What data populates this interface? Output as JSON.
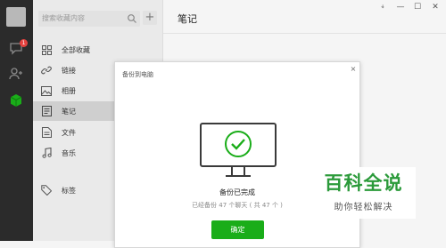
{
  "search": {
    "placeholder": "搜索收藏内容"
  },
  "side": {
    "badge": "1"
  },
  "menu": [
    {
      "label": "全部收藏",
      "icon": "grid-icon"
    },
    {
      "label": "链接",
      "icon": "link-icon"
    },
    {
      "label": "相册",
      "icon": "image-icon"
    },
    {
      "label": "笔记",
      "icon": "note-icon",
      "active": true
    },
    {
      "label": "文件",
      "icon": "file-icon"
    },
    {
      "label": "音乐",
      "icon": "music-icon"
    },
    {
      "label": "标签",
      "icon": "tag-icon"
    }
  ],
  "page": {
    "title": "笔记"
  },
  "window": {
    "pin": "⍖",
    "minimize": "—",
    "maximize": "☐",
    "close": "✕"
  },
  "dialog": {
    "title": "备份到电脑",
    "close": "×",
    "status": "备份已完成",
    "detail": "已经备份 47 个聊天 ( 共 47 个 )",
    "confirm": "确定"
  },
  "watermark": {
    "title": "百科全说",
    "subtitle": "助你轻松解决"
  },
  "colors": {
    "accent": "#1aad19",
    "sidebar": "#2b2b2b",
    "badge": "#e64340",
    "watermark": "#2b9a3a"
  }
}
